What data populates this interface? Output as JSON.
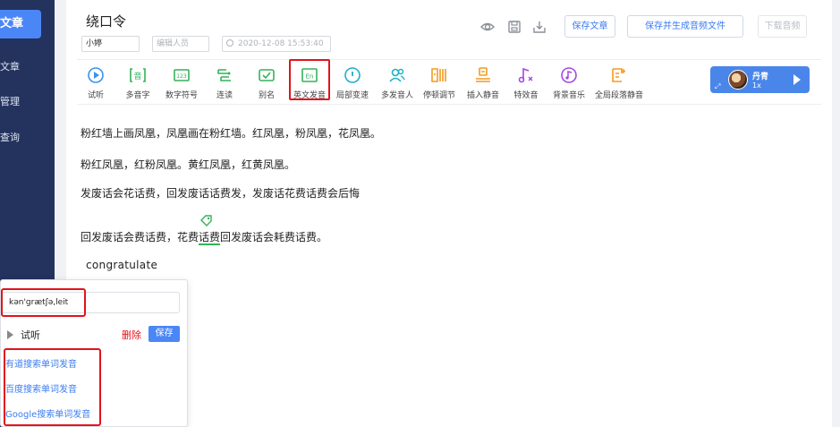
{
  "sidebar": {
    "active_label": "文章",
    "items": [
      {
        "label": "文章"
      },
      {
        "label": "管理"
      },
      {
        "label": "查询"
      }
    ]
  },
  "header": {
    "title": "绕口令",
    "author_value": "小婷",
    "editor_placeholder": "编辑人员",
    "timestamp": "2020-12-08 15:53:40",
    "buttons": {
      "save_article": "保存文章",
      "save_generate": "保存并生成音频文件",
      "download_audio": "下载音频"
    }
  },
  "toolbar": {
    "tools": [
      {
        "label": "试听",
        "icon": "play-circle-icon"
      },
      {
        "label": "多音字",
        "icon": "polyphone-icon"
      },
      {
        "label": "数字符号",
        "icon": "number-icon"
      },
      {
        "label": "连读",
        "icon": "liaison-icon"
      },
      {
        "label": "别名",
        "icon": "alias-icon"
      },
      {
        "label": "英文发音",
        "icon": "english-icon"
      },
      {
        "label": "局部变速",
        "icon": "speed-icon"
      },
      {
        "label": "多发音人",
        "icon": "multi-speaker-icon"
      },
      {
        "label": "停顿调节",
        "icon": "pause-icon"
      },
      {
        "label": "插入静音",
        "icon": "insert-silence-icon"
      },
      {
        "label": "特效音",
        "icon": "effect-sound-icon"
      },
      {
        "label": "背景音乐",
        "icon": "background-music-icon"
      },
      {
        "label": "全局段落静音",
        "icon": "paragraph-silence-icon"
      }
    ],
    "en_icon_text": "En",
    "player": {
      "name": "丹青",
      "speed": "1x"
    }
  },
  "content": {
    "paragraphs": [
      "粉红墙上画凤凰，凤凰画在粉红墙。红凤凰，粉凤凰，花凤凰。",
      "粉红凤凰，红粉凤凰。黄红凤凰，红黄凤凰。",
      "发废话会花话费，回发废话话费发，发废话花费话费会后悔"
    ],
    "para4_before": "回发废话会费话费，花费",
    "para4_mark": "话费",
    "para4_after": "回发废话会耗费话费。",
    "english_word": "congratulate"
  },
  "popup": {
    "ipa_value": "kən'ɡrætʃə,leit",
    "listen_label": "试听",
    "delete_label": "删除",
    "save_label": "保存",
    "links": [
      "有道搜索单词发音",
      "百度搜索单词发音",
      "Google搜索单词发音"
    ]
  },
  "colors": {
    "sidebar_bg": "#24325e",
    "accent": "#4b86f7",
    "highlight_red": "#e0141e",
    "icon_blue": "#3b8ff0",
    "icon_green": "#35b25a",
    "icon_teal": "#1bb0c8",
    "icon_orange": "#f39a1e",
    "icon_purple": "#a448e0"
  }
}
